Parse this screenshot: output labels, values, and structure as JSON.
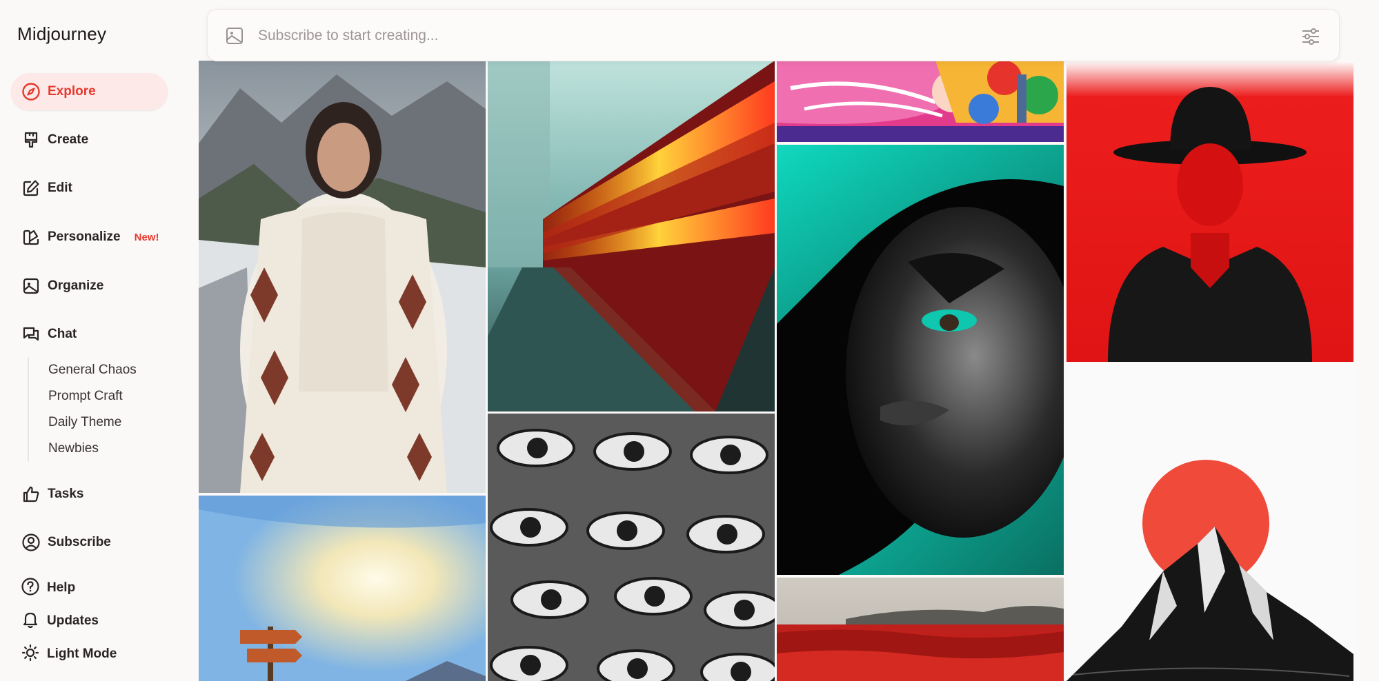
{
  "app": {
    "title": "Midjourney"
  },
  "nav": {
    "explore": "Explore",
    "create": "Create",
    "edit": "Edit",
    "personalize": "Personalize",
    "personalize_badge": "New!",
    "organize": "Organize",
    "chat": "Chat",
    "chat_channels": [
      "General Chaos",
      "Prompt Craft",
      "Daily Theme",
      "Newbies"
    ],
    "tasks": "Tasks",
    "subscribe": "Subscribe",
    "help": "Help",
    "updates": "Updates",
    "light_mode": "Light Mode"
  },
  "search": {
    "placeholder": "Subscribe to start creating..."
  },
  "colors": {
    "accent": "#e6392e",
    "active_bg": "#fde9e8"
  },
  "gallery": {
    "images": [
      "woman-in-white-knitted-coat-snowy-road",
      "train-motion-blur-platform",
      "colorful-cat-illustration",
      "woman-face-teal-black",
      "faceless-man-black-hat-red",
      "signpost-painting-sunny-sky",
      "many-eyes-black-and-white",
      "red-flower-field",
      "red-sun-ink-mountain"
    ]
  }
}
